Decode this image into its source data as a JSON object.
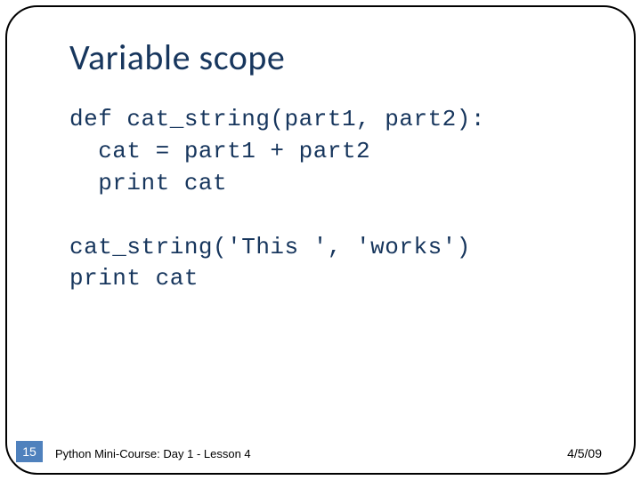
{
  "title": "Variable scope",
  "code": "def cat_string(part1, part2):\n  cat = part1 + part2\n  print cat\n\ncat_string('This ', 'works')\nprint cat",
  "footer": {
    "slide_number": "15",
    "left_text": "Python Mini-Course: Day 1 - Lesson 4",
    "right_text": "4/5/09"
  }
}
